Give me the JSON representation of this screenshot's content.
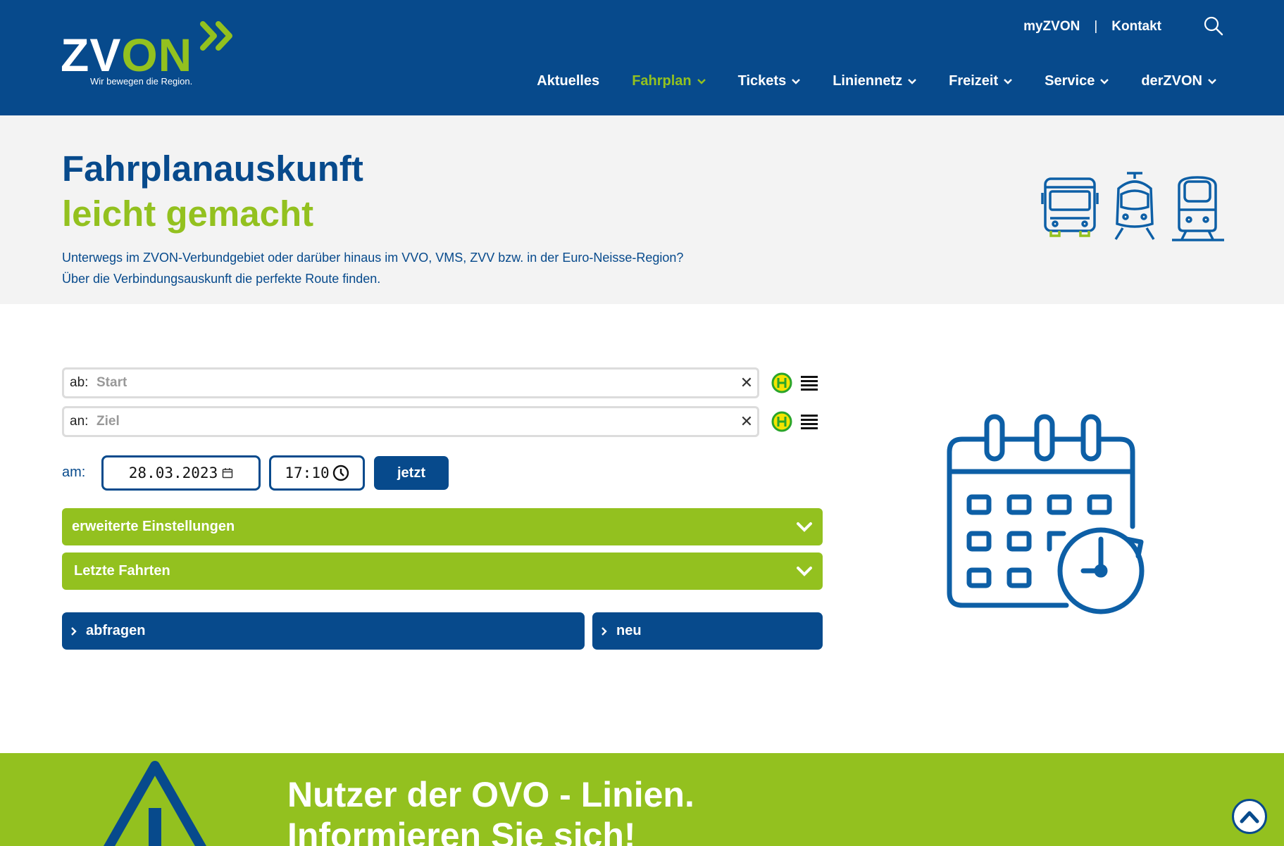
{
  "header": {
    "logo": {
      "word_left": "ZV",
      "word_right": "ON",
      "tagline": "Wir bewegen die Region."
    },
    "top_links": [
      "myZVON",
      "Kontakt"
    ],
    "separator": "|",
    "nav": [
      {
        "label": "Aktuelles",
        "dropdown": false,
        "active": false
      },
      {
        "label": "Fahrplan",
        "dropdown": true,
        "active": true
      },
      {
        "label": "Tickets",
        "dropdown": true,
        "active": false
      },
      {
        "label": "Liniennetz",
        "dropdown": true,
        "active": false
      },
      {
        "label": "Freizeit",
        "dropdown": true,
        "active": false
      },
      {
        "label": "Service",
        "dropdown": true,
        "active": false
      },
      {
        "label": "derZVON",
        "dropdown": true,
        "active": false
      }
    ]
  },
  "hero": {
    "title": "Fahrplanauskunft",
    "subtitle": "leicht gemacht",
    "text_line1": "Unterwegs im ZVON-Verbundgebiet oder darüber hinaus im VVO, VMS, ZVV bzw. in der Euro-Neisse-Region?",
    "text_line2": "Über die Verbindungsauskunft die perfekte Route finden.",
    "icons": [
      "bus-icon",
      "tram-icon",
      "train-icon"
    ]
  },
  "form": {
    "from": {
      "prefix": "ab:",
      "placeholder": "Start",
      "value": ""
    },
    "to": {
      "prefix": "an:",
      "placeholder": "Ziel",
      "value": ""
    },
    "clear_symbol": "✕",
    "date_label": "am:",
    "date": "28.03.2023",
    "time": "17:10",
    "now_label": "jetzt",
    "advanced_label": "erweiterte Einstellungen",
    "recent_label": "Letzte Fahrten",
    "query_label": "abfragen",
    "new_label": "neu"
  },
  "banner": {
    "title": "Nutzer der OVO - Linien.",
    "subtitle": "Informieren Sie sich!"
  },
  "colors": {
    "brand_blue": "#074a8c",
    "brand_green": "#93c11f",
    "hero_bg": "#f3f3f3"
  }
}
